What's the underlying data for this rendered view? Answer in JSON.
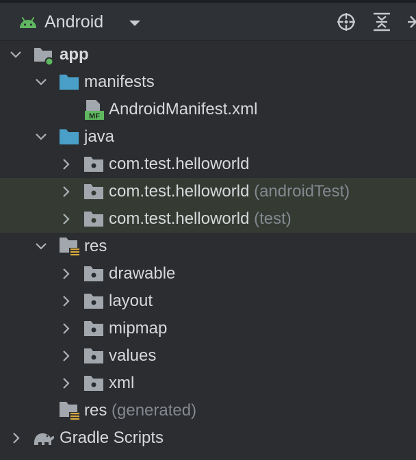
{
  "toolbar": {
    "view_label": "Android",
    "icons": [
      "android-icon",
      "dropdown-caret-icon",
      "locate-target-icon",
      "collapse-all-icon",
      "split-icon"
    ]
  },
  "colors": {
    "background": "#2b2d30",
    "highlight": "#353b33",
    "folder_blue": "#4a9fc9",
    "folder_gray": "#a2a7ad",
    "module_dot": "#5fb860",
    "android_green": "#5fb860",
    "text": "#d6d8db",
    "text_dim": "#848890"
  },
  "tree": {
    "app": {
      "label": "app",
      "state": "expanded"
    },
    "manifests": {
      "label": "manifests",
      "state": "expanded"
    },
    "android_manifest": {
      "label": "AndroidManifest.xml",
      "badge": "MF"
    },
    "java": {
      "label": "java",
      "state": "expanded"
    },
    "pkg_main": {
      "label": "com.test.helloworld",
      "state": "collapsed"
    },
    "pkg_android_test": {
      "label": "com.test.helloworld",
      "suffix": "(androidTest)",
      "state": "collapsed"
    },
    "pkg_test": {
      "label": "com.test.helloworld",
      "suffix": "(test)",
      "state": "collapsed"
    },
    "res": {
      "label": "res",
      "state": "expanded"
    },
    "drawable": {
      "label": "drawable",
      "state": "collapsed"
    },
    "layout": {
      "label": "layout",
      "state": "collapsed"
    },
    "mipmap": {
      "label": "mipmap",
      "state": "collapsed"
    },
    "values": {
      "label": "values",
      "state": "collapsed"
    },
    "xml": {
      "label": "xml",
      "state": "collapsed"
    },
    "res_generated": {
      "label": "res",
      "suffix": "(generated)"
    },
    "gradle_scripts": {
      "label": "Gradle Scripts",
      "state": "collapsed"
    }
  }
}
